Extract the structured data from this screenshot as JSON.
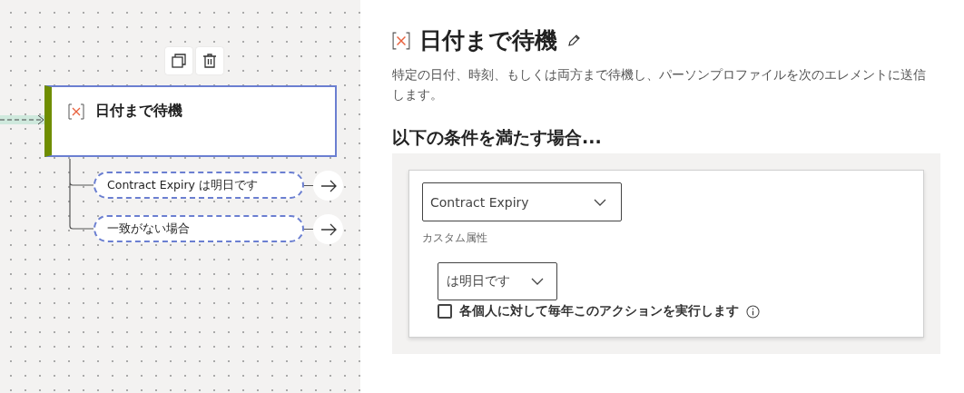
{
  "canvas": {
    "node": {
      "title": "日付まで待機",
      "selected": true
    },
    "branches": [
      {
        "label": "Contract Expiry は明日です"
      },
      {
        "label": "一致がない場合"
      }
    ]
  },
  "panel": {
    "title": "日付まで待機",
    "description": "特定の日付、時刻、もしくは両方まで待機し、パーソンプロファイルを次のエレメントに送信します。",
    "heading": "以下の条件を満たす場合...",
    "attribute": {
      "value": "Contract Expiry",
      "label": "カスタム属性"
    },
    "operator": {
      "value": "は明日です"
    },
    "repeat": {
      "label": "各個人に対して毎年このアクションを実行します",
      "checked": false
    }
  }
}
